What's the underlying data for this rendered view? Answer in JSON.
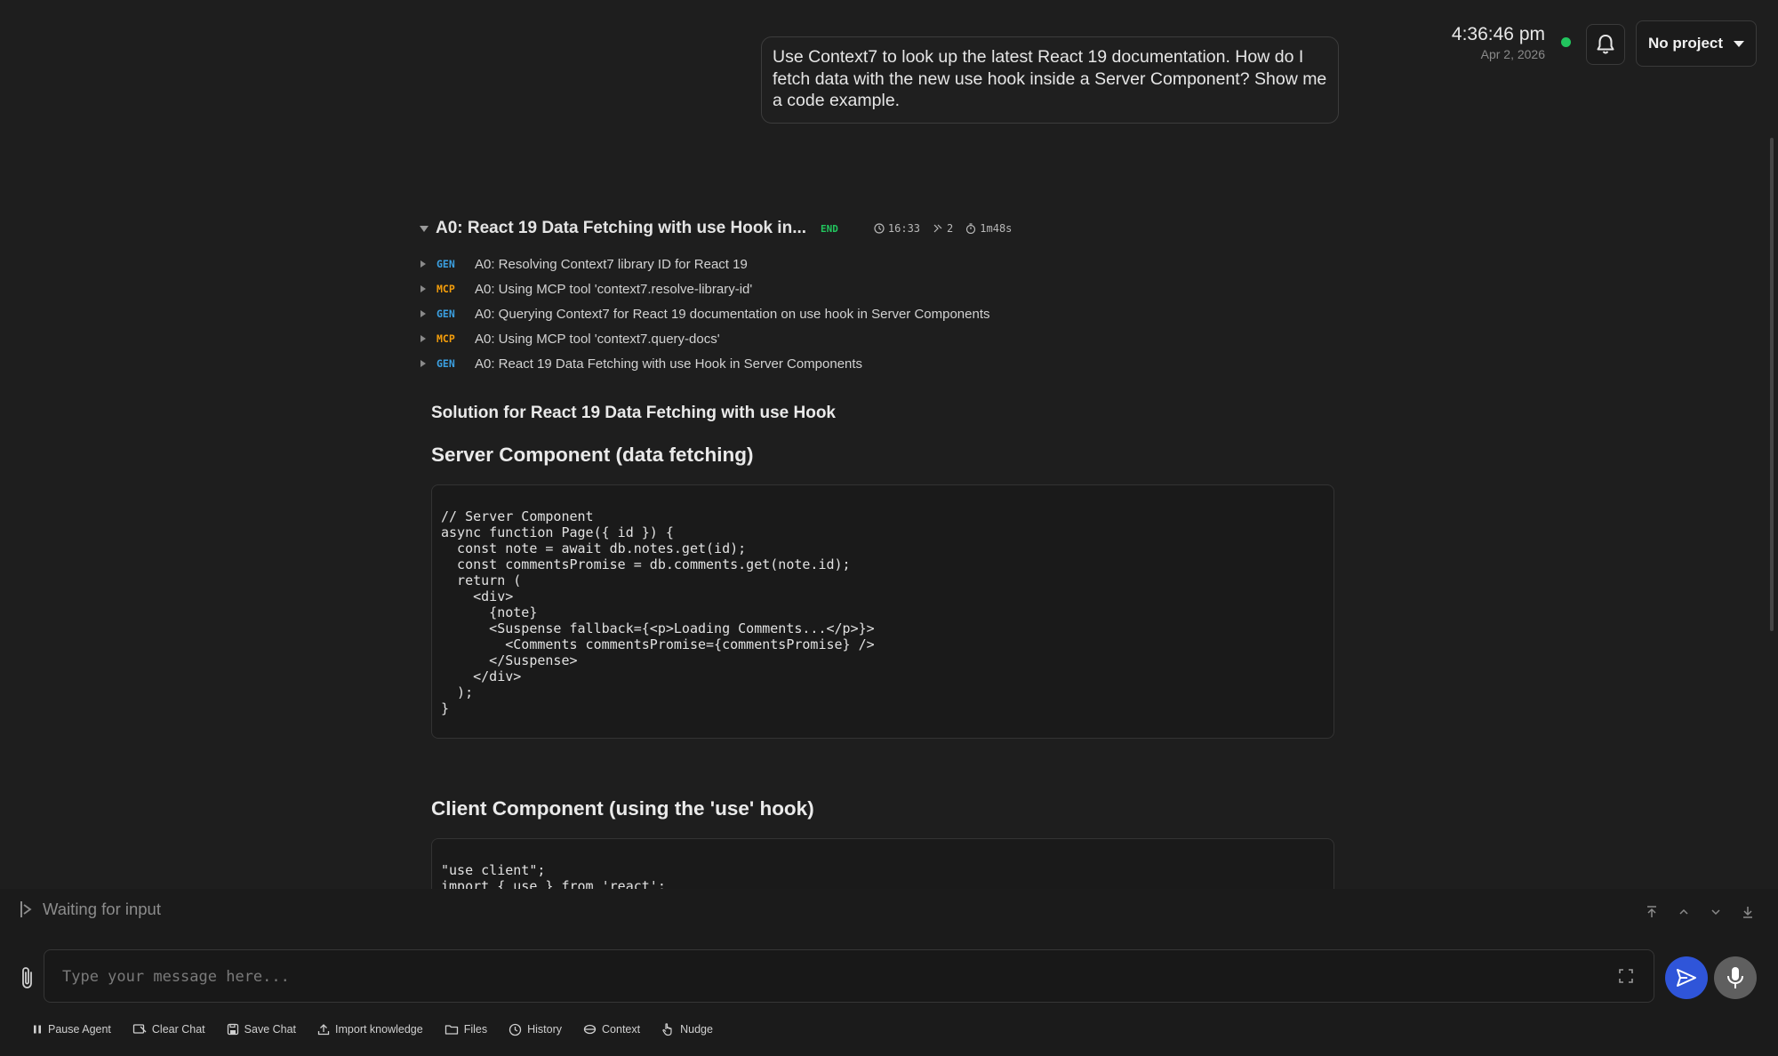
{
  "header": {
    "time": "4:36:46 pm",
    "date": "Apr 2, 2026",
    "project_label": "No project",
    "status_color": "#22c55e"
  },
  "user_message": "Use Context7 to look up the latest React 19 documentation. How do I fetch data with the new use hook inside a Server Component? Show me a code example.",
  "agent": {
    "title": "A0: React 19 Data Fetching with use Hook in...",
    "status": "END",
    "time": "16:33",
    "steps_count": "2",
    "duration": "1m48s",
    "steps": [
      {
        "tag": "GEN",
        "label": "A0: Resolving Context7 library ID for React 19"
      },
      {
        "tag": "MCP",
        "label": "A0: Using MCP tool 'context7.resolve-library-id'"
      },
      {
        "tag": "GEN",
        "label": "A0: Querying Context7 for React 19 documentation on use hook in Server Components"
      },
      {
        "tag": "MCP",
        "label": "A0: Using MCP tool 'context7.query-docs'"
      },
      {
        "tag": "GEN",
        "label": "A0: React 19 Data Fetching with use Hook in Server Components"
      }
    ]
  },
  "response": {
    "heading": "Solution for React 19 Data Fetching with use Hook",
    "section1_title": "Server Component (data fetching)",
    "code1": "// Server Component\nasync function Page({ id }) {\n  const note = await db.notes.get(id);\n  const commentsPromise = db.comments.get(note.id);\n  return (\n    <div>\n      {note}\n      <Suspense fallback={<p>Loading Comments...</p>}>\n        <Comments commentsPromise={commentsPromise} />\n      </Suspense>\n    </div>\n  );\n}",
    "section2_title": "Client Component (using the 'use' hook)",
    "code2": "\"use client\";\nimport { use } from 'react';"
  },
  "input": {
    "status_text": "Waiting for input",
    "placeholder": "Type your message here..."
  },
  "toolbar": {
    "pause": "Pause Agent",
    "clear": "Clear Chat",
    "save": "Save Chat",
    "import": "Import knowledge",
    "files": "Files",
    "history": "History",
    "context": "Context",
    "nudge": "Nudge"
  },
  "icons": [
    "bell-icon",
    "chevron-down-icon",
    "clock-icon",
    "steps-icon",
    "timer-icon",
    "scroll-top-icon",
    "scroll-up-icon",
    "scroll-down-icon",
    "scroll-bottom-icon",
    "paperclip-icon",
    "expand-icon",
    "send-icon",
    "microphone-icon",
    "pause-icon",
    "clear-chat-icon",
    "save-icon",
    "upload-icon",
    "folder-icon",
    "history-icon",
    "context-icon",
    "hand-icon"
  ],
  "colors": {
    "accent_blue": "#2f55d9",
    "gen_tag": "#3b9fe0",
    "mcp_tag": "#f59e0b",
    "end_badge": "#22c55e"
  }
}
